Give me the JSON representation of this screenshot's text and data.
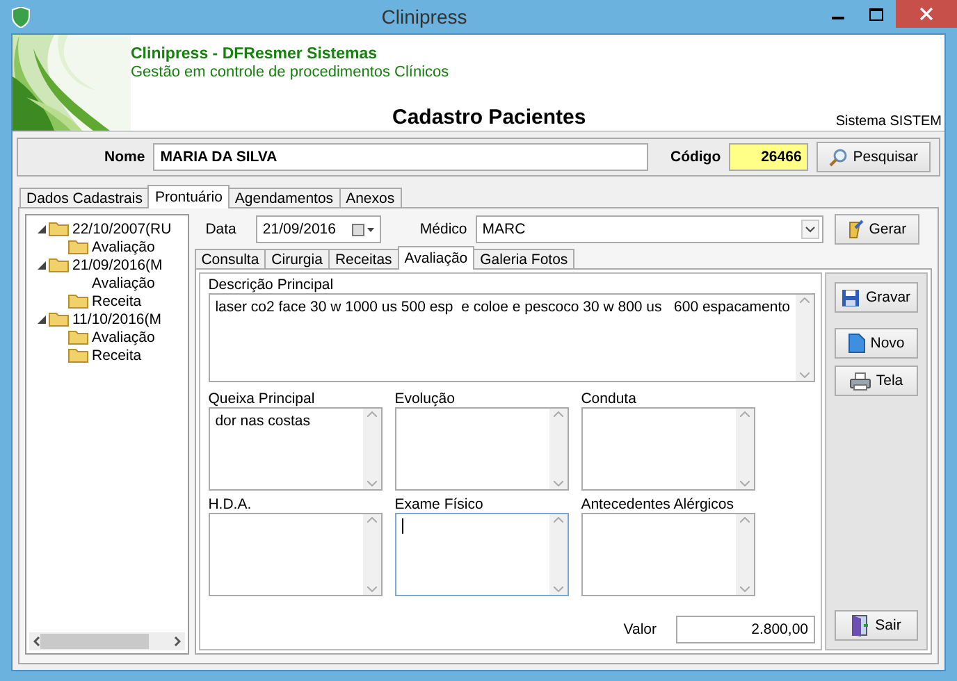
{
  "window": {
    "title": "Clinipress"
  },
  "header": {
    "company": "Clinipress - DFResmer Sistemas",
    "subtitle": "Gestão em controle de procedimentos Clínicos",
    "title": "Cadastro Pacientes",
    "system": "Sistema SISTEM"
  },
  "patient": {
    "name_label": "Nome",
    "name": "MARIA DA SILVA",
    "code_label": "Código",
    "code": "26466",
    "search_button": "Pesquisar"
  },
  "tabs": [
    {
      "label": "Dados Cadastrais",
      "selected": false
    },
    {
      "label": "Prontuário",
      "selected": true
    },
    {
      "label": "Agendamentos",
      "selected": false
    },
    {
      "label": "Anexos",
      "selected": false
    }
  ],
  "tree": [
    {
      "label": "22/10/2007(RU",
      "expanded": true,
      "children": [
        {
          "label": "Avaliação",
          "kind": "folder"
        }
      ]
    },
    {
      "label": "21/09/2016(M",
      "expanded": true,
      "children": [
        {
          "label": "Avaliação",
          "kind": "plain"
        },
        {
          "label": "Receita",
          "kind": "folder"
        }
      ]
    },
    {
      "label": "11/10/2016(M",
      "expanded": true,
      "children": [
        {
          "label": "Avaliação",
          "kind": "folder"
        },
        {
          "label": "Receita",
          "kind": "folder"
        }
      ]
    }
  ],
  "record": {
    "date_label": "Data",
    "date": "21/09/2016",
    "doctor_label": "Médico",
    "doctor": "MARC",
    "generate_button": "Gerar"
  },
  "subtabs": [
    {
      "label": "Consulta",
      "selected": false
    },
    {
      "label": "Cirurgia",
      "selected": false
    },
    {
      "label": "Receitas",
      "selected": false
    },
    {
      "label": "Avaliação",
      "selected": true
    },
    {
      "label": "Galeria Fotos",
      "selected": false
    }
  ],
  "description": {
    "label": "Descrição Principal",
    "value": "laser co2 face 30 w 1000 us 500 esp  e coloe e pescoco 30 w 800 us   600 espacamento"
  },
  "fields": [
    {
      "label": "Queixa Principal",
      "value": "dor nas costas",
      "focused": false
    },
    {
      "label": "Evolução",
      "focused": false
    },
    {
      "label": "Conduta",
      "focused": false
    },
    {
      "label": "H.D.A.",
      "focused": false
    },
    {
      "label": "Exame Físico",
      "focused": true
    },
    {
      "label": "Antecedentes Alérgicos",
      "focused": false
    }
  ],
  "valor": {
    "label": "Valor",
    "value": "2.800,00"
  },
  "actions": [
    {
      "label": "Gravar",
      "kind": "save"
    },
    {
      "label": "Novo",
      "kind": "new"
    },
    {
      "label": "Tela",
      "kind": "print"
    }
  ],
  "exit_button": {
    "label": "Sair",
    "kind": "exit"
  }
}
